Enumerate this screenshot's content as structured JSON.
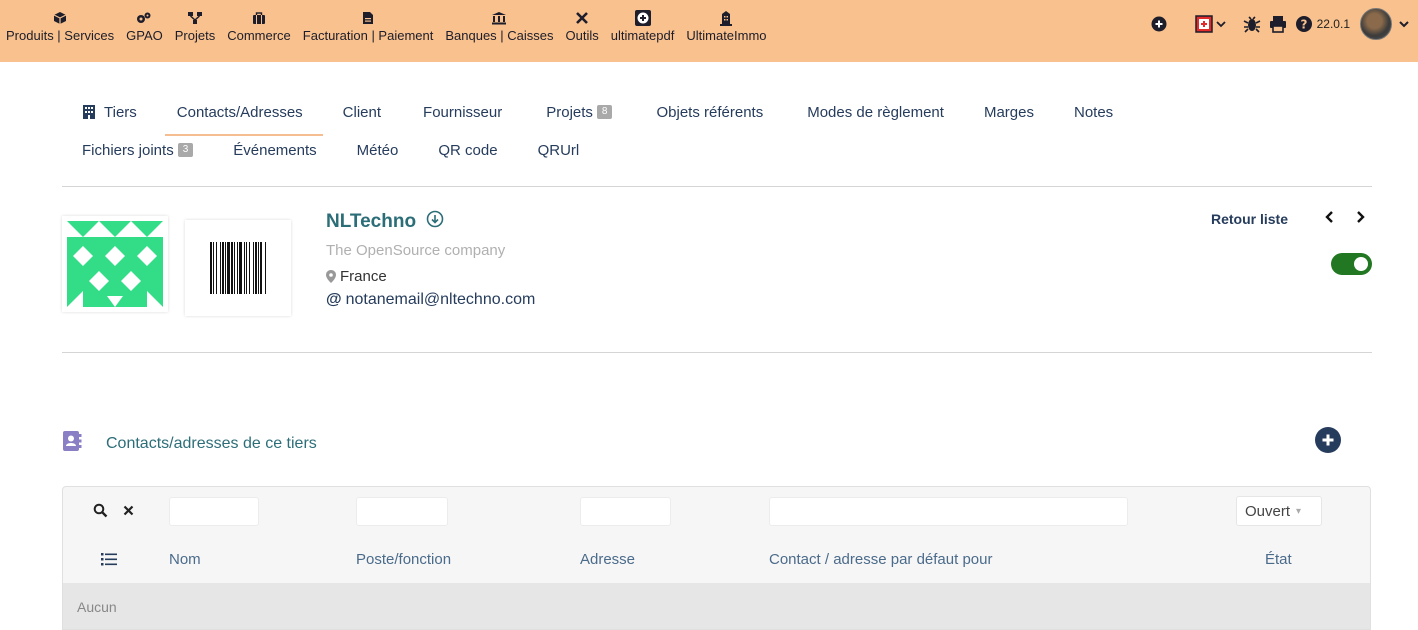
{
  "menu": [
    {
      "label": "Produits | Services",
      "icon": "cube-icon"
    },
    {
      "label": "GPAO",
      "icon": "cogs-icon"
    },
    {
      "label": "Projets",
      "icon": "sitemap-icon"
    },
    {
      "label": "Commerce",
      "icon": "suitcase-icon"
    },
    {
      "label": "Facturation | Paiement",
      "icon": "invoice-icon"
    },
    {
      "label": "Banques | Caisses",
      "icon": "bank-icon"
    },
    {
      "label": "Outils",
      "icon": "tools-icon"
    },
    {
      "label": "ultimatepdf",
      "icon": "plus-square-icon"
    },
    {
      "label": "UltimateImmo",
      "icon": "building-icon"
    }
  ],
  "topright": {
    "version": "22.0.1"
  },
  "tabs_row1": [
    {
      "label": "Tiers",
      "icon": "building-icon"
    },
    {
      "label": "Contacts/Adresses",
      "active": true
    },
    {
      "label": "Client"
    },
    {
      "label": "Fournisseur"
    },
    {
      "label": "Projets",
      "badge": "8"
    },
    {
      "label": "Objets référents"
    },
    {
      "label": "Modes de règlement"
    },
    {
      "label": "Marges"
    },
    {
      "label": "Notes"
    }
  ],
  "tabs_row2": [
    {
      "label": "Fichiers joints",
      "badge": "3"
    },
    {
      "label": "Événements"
    },
    {
      "label": "Météo"
    },
    {
      "label": "QR code"
    },
    {
      "label": "QRUrl"
    }
  ],
  "company": {
    "name": "NLTechno",
    "slogan": "The OpenSource company",
    "country": "France",
    "email": "notanemail@nltechno.com",
    "status_enabled": true
  },
  "nav": {
    "back_label": "Retour liste",
    "prev": "<",
    "next": ">"
  },
  "contacts": {
    "title": "Contacts/adresses de ce tiers",
    "filter_select": "Ouvert",
    "columns": [
      "Nom",
      "Poste/fonction",
      "Adresse",
      "Contact / adresse par défaut pour",
      "État"
    ],
    "empty_text": "Aucun"
  },
  "colors": {
    "topbar": "#f8c18d",
    "accent": "#263c5c",
    "title": "#2c6e78",
    "toggle": "#227722",
    "logo": "#33dd88"
  }
}
